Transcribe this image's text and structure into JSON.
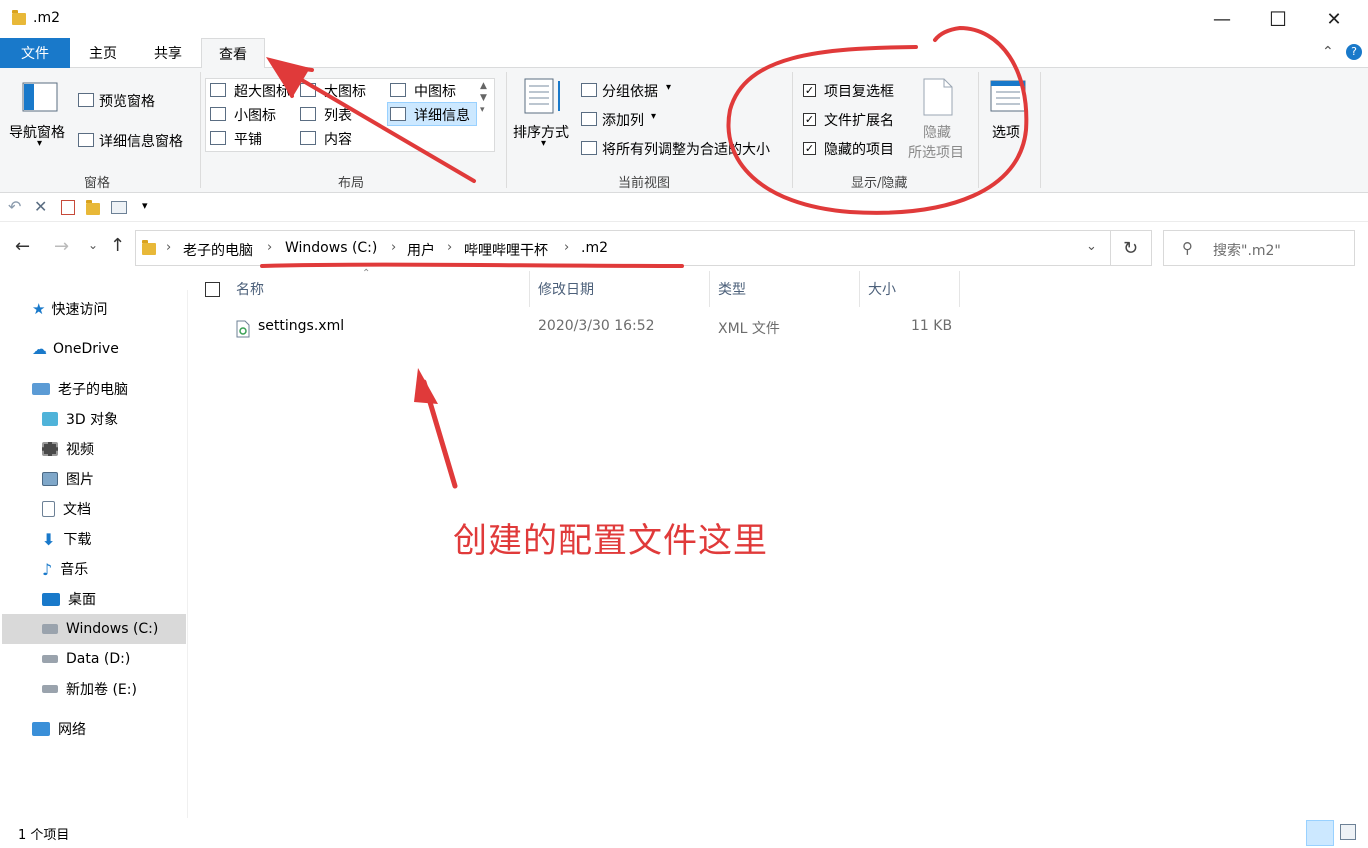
{
  "window": {
    "title": ".m2",
    "minimize_glyph": "—",
    "maximize_glyph": "☐",
    "close_glyph": "✕"
  },
  "tabs": {
    "file": "文件",
    "home": "主页",
    "share": "共享",
    "view": "查看"
  },
  "ribbon": {
    "panes": {
      "nav_pane": "导航窗格",
      "preview_pane": "预览窗格",
      "details_pane": "详细信息窗格",
      "group_label": "窗格"
    },
    "layout": {
      "items": [
        "超大图标",
        "大图标",
        "中图标",
        "小图标",
        "列表",
        "详细信息",
        "平铺",
        "内容"
      ],
      "group_label": "布局"
    },
    "current_view": {
      "sort_by": "排序方式",
      "group_by": "分组依据",
      "add_columns": "添加列",
      "fit_columns": "将所有列调整为合适的大小",
      "group_label": "当前视图"
    },
    "show_hide": {
      "item_checkboxes": "项目复选框",
      "file_extensions": "文件扩展名",
      "hidden_items": "隐藏的项目",
      "hide_selected_1": "隐藏",
      "hide_selected_2": "所选项目",
      "group_label": "显示/隐藏",
      "item_checkboxes_checked": true,
      "file_extensions_checked": true,
      "hidden_items_checked": true
    },
    "options": "选项"
  },
  "address": {
    "crumbs": [
      "老子的电脑",
      "Windows (C:)",
      "用户",
      "哔哩哔哩干杯",
      ".m2"
    ],
    "search_placeholder": "搜索\".m2\""
  },
  "sidebar": {
    "items": [
      "快速访问",
      "OneDrive",
      "老子的电脑",
      "3D 对象",
      "视频",
      "图片",
      "文档",
      "下载",
      "音乐",
      "桌面",
      "Windows (C:)",
      "Data (D:)",
      "新加卷 (E:)",
      "网络"
    ]
  },
  "columns": {
    "name": "名称",
    "modified": "修改日期",
    "type": "类型",
    "size": "大小"
  },
  "files": [
    {
      "name": "settings.xml",
      "modified": "2020/3/30 16:52",
      "type": "XML 文件",
      "size": "11 KB"
    }
  ],
  "status": {
    "count": "1 个项目"
  },
  "annotation": {
    "text": "创建的配置文件这里",
    "color": "#e03a3a"
  }
}
